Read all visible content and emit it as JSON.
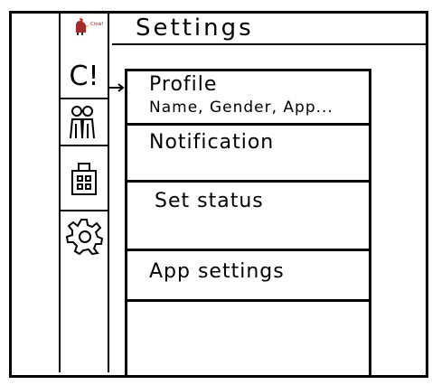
{
  "app": {
    "brand_label": "Crow!"
  },
  "header": {
    "title": "Settings"
  },
  "sidebar": {
    "items": [
      {
        "label": "C!",
        "icon": "chat-icon"
      },
      {
        "label": "",
        "icon": "people-icon"
      },
      {
        "label": "",
        "icon": "calendar-icon"
      },
      {
        "label": "",
        "icon": "gear-icon"
      }
    ]
  },
  "settings": {
    "items": [
      {
        "label": "Profile",
        "sub": "Name, Gender, App..."
      },
      {
        "label": "Notification"
      },
      {
        "label": "Set status"
      },
      {
        "label": "App settings"
      }
    ]
  }
}
